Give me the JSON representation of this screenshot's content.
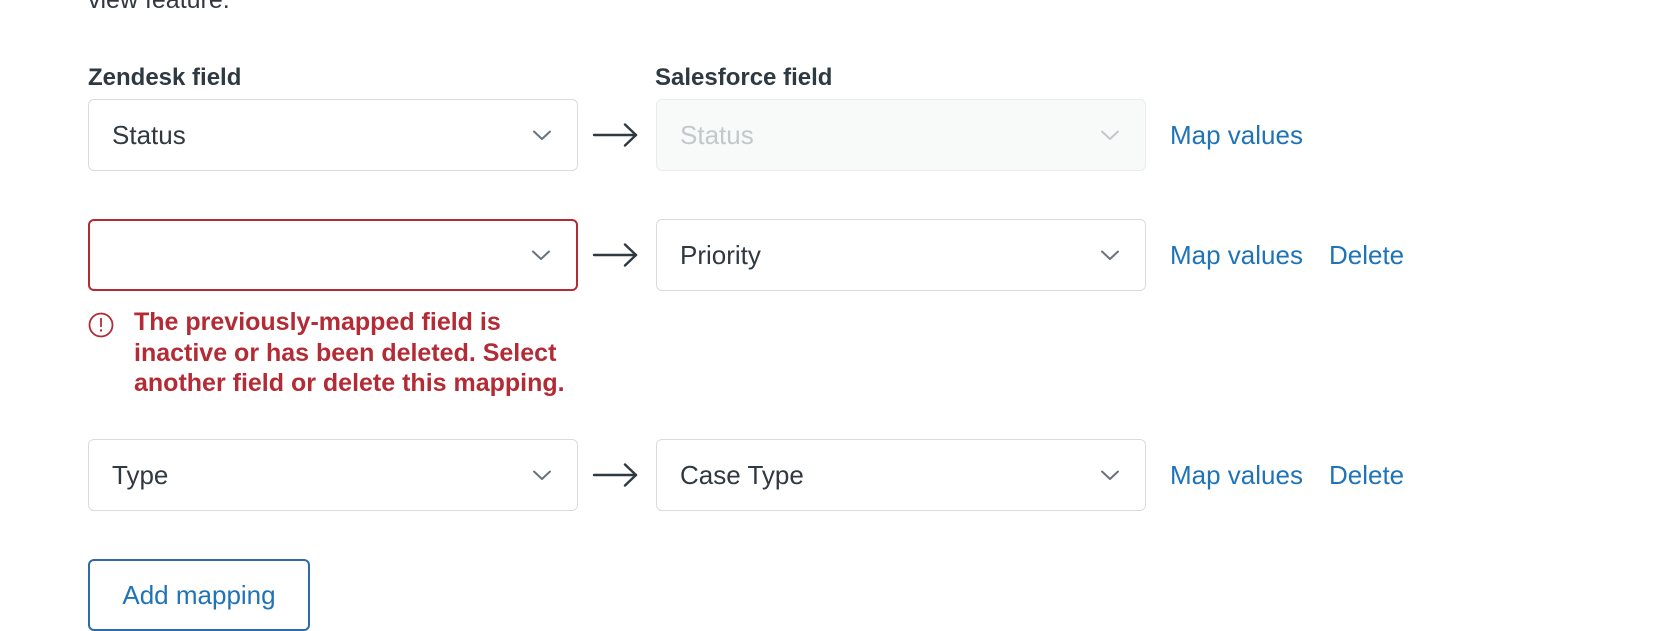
{
  "intro": {
    "truncated_text": "view feature."
  },
  "headers": {
    "zendesk": "Zendesk field",
    "salesforce": "Salesforce field"
  },
  "icons": {
    "chevron": "chevron-down-icon",
    "arrow": "arrow-right-icon",
    "error": "error-circle-icon"
  },
  "colors": {
    "link": "#1f73b7",
    "error": "#b32b35",
    "text": "#2f3941",
    "border": "#d8dcde",
    "disabled_bg": "#f8f9f9",
    "disabled_text": "#c2c8cc"
  },
  "rows": [
    {
      "zendesk_value": "Status",
      "zendesk_placeholder": "",
      "salesforce_value": "Status",
      "salesforce_disabled": true,
      "map_values_label": "Map values",
      "delete_label": "",
      "has_delete": false,
      "error": null
    },
    {
      "zendesk_value": "",
      "zendesk_placeholder": "",
      "salesforce_value": "Priority",
      "salesforce_disabled": false,
      "map_values_label": "Map values",
      "delete_label": "Delete",
      "has_delete": true,
      "error": "The previously-mapped field is inactive or has been deleted. Select another field or delete this mapping."
    },
    {
      "zendesk_value": "Type",
      "zendesk_placeholder": "",
      "salesforce_value": "Case Type",
      "salesforce_disabled": false,
      "map_values_label": "Map values",
      "delete_label": "Delete",
      "has_delete": true,
      "error": null
    }
  ],
  "add_button": {
    "label": "Add mapping"
  }
}
